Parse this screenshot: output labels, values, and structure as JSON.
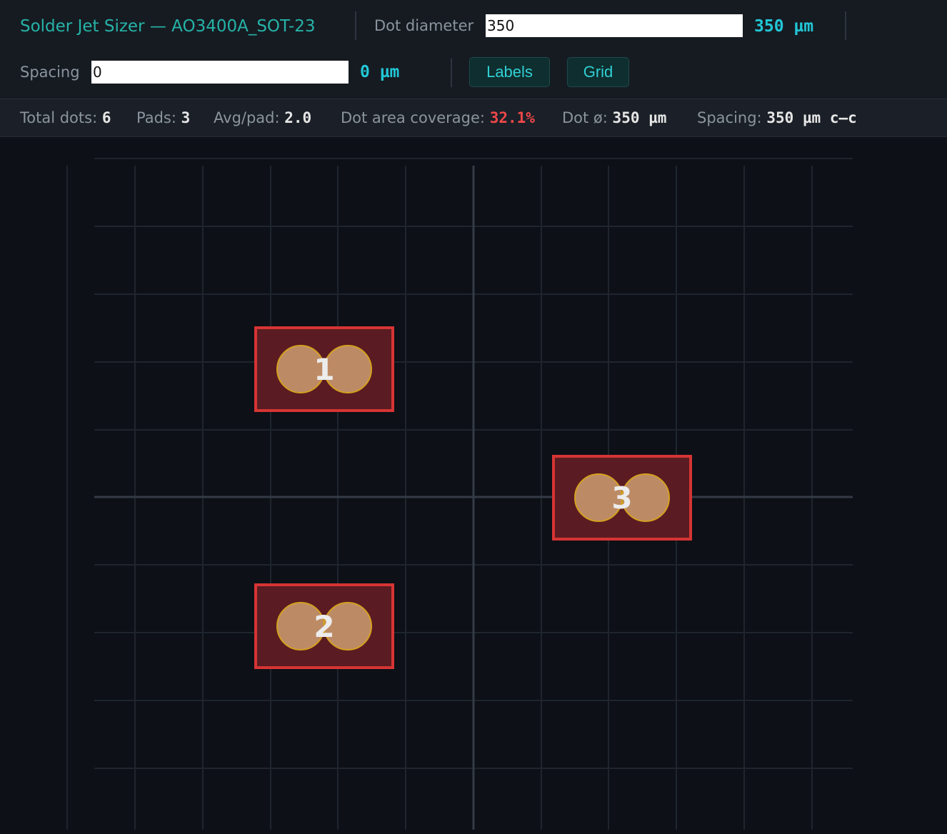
{
  "app": {
    "title": "Solder Jet Sizer — AO3400A_SOT-23"
  },
  "controls": {
    "dot_diameter": {
      "label": "Dot diameter",
      "value": "350",
      "readout": "350 µm"
    },
    "spacing": {
      "label": "Spacing",
      "value": "0",
      "readout": "0 µm"
    },
    "labels_button": "Labels",
    "grid_button": "Grid"
  },
  "stats": {
    "total_dots_label": "Total dots:",
    "total_dots": "6",
    "pads_label": "Pads:",
    "pads": "3",
    "avg_label": "Avg/pad:",
    "avg": "2.0",
    "coverage_label": "Dot area coverage:",
    "coverage": "32.1%",
    "dot_d_label": "Dot ø:",
    "dot_d": "350 µm",
    "spacing_label": "Spacing:",
    "spacing": "350 µm c–c"
  },
  "colors": {
    "accent": "#26b3a8",
    "readout": "#22c7d6",
    "warning": "#f0484a",
    "pad_outline": "#d63434",
    "pad_fill": "#5a1c22",
    "dot_fill": "#c2916a",
    "dot_outline": "#d4a020"
  },
  "board": {
    "pads": [
      {
        "label": "1",
        "dots": 2
      },
      {
        "label": "2",
        "dots": 2
      },
      {
        "label": "3",
        "dots": 2
      }
    ]
  }
}
